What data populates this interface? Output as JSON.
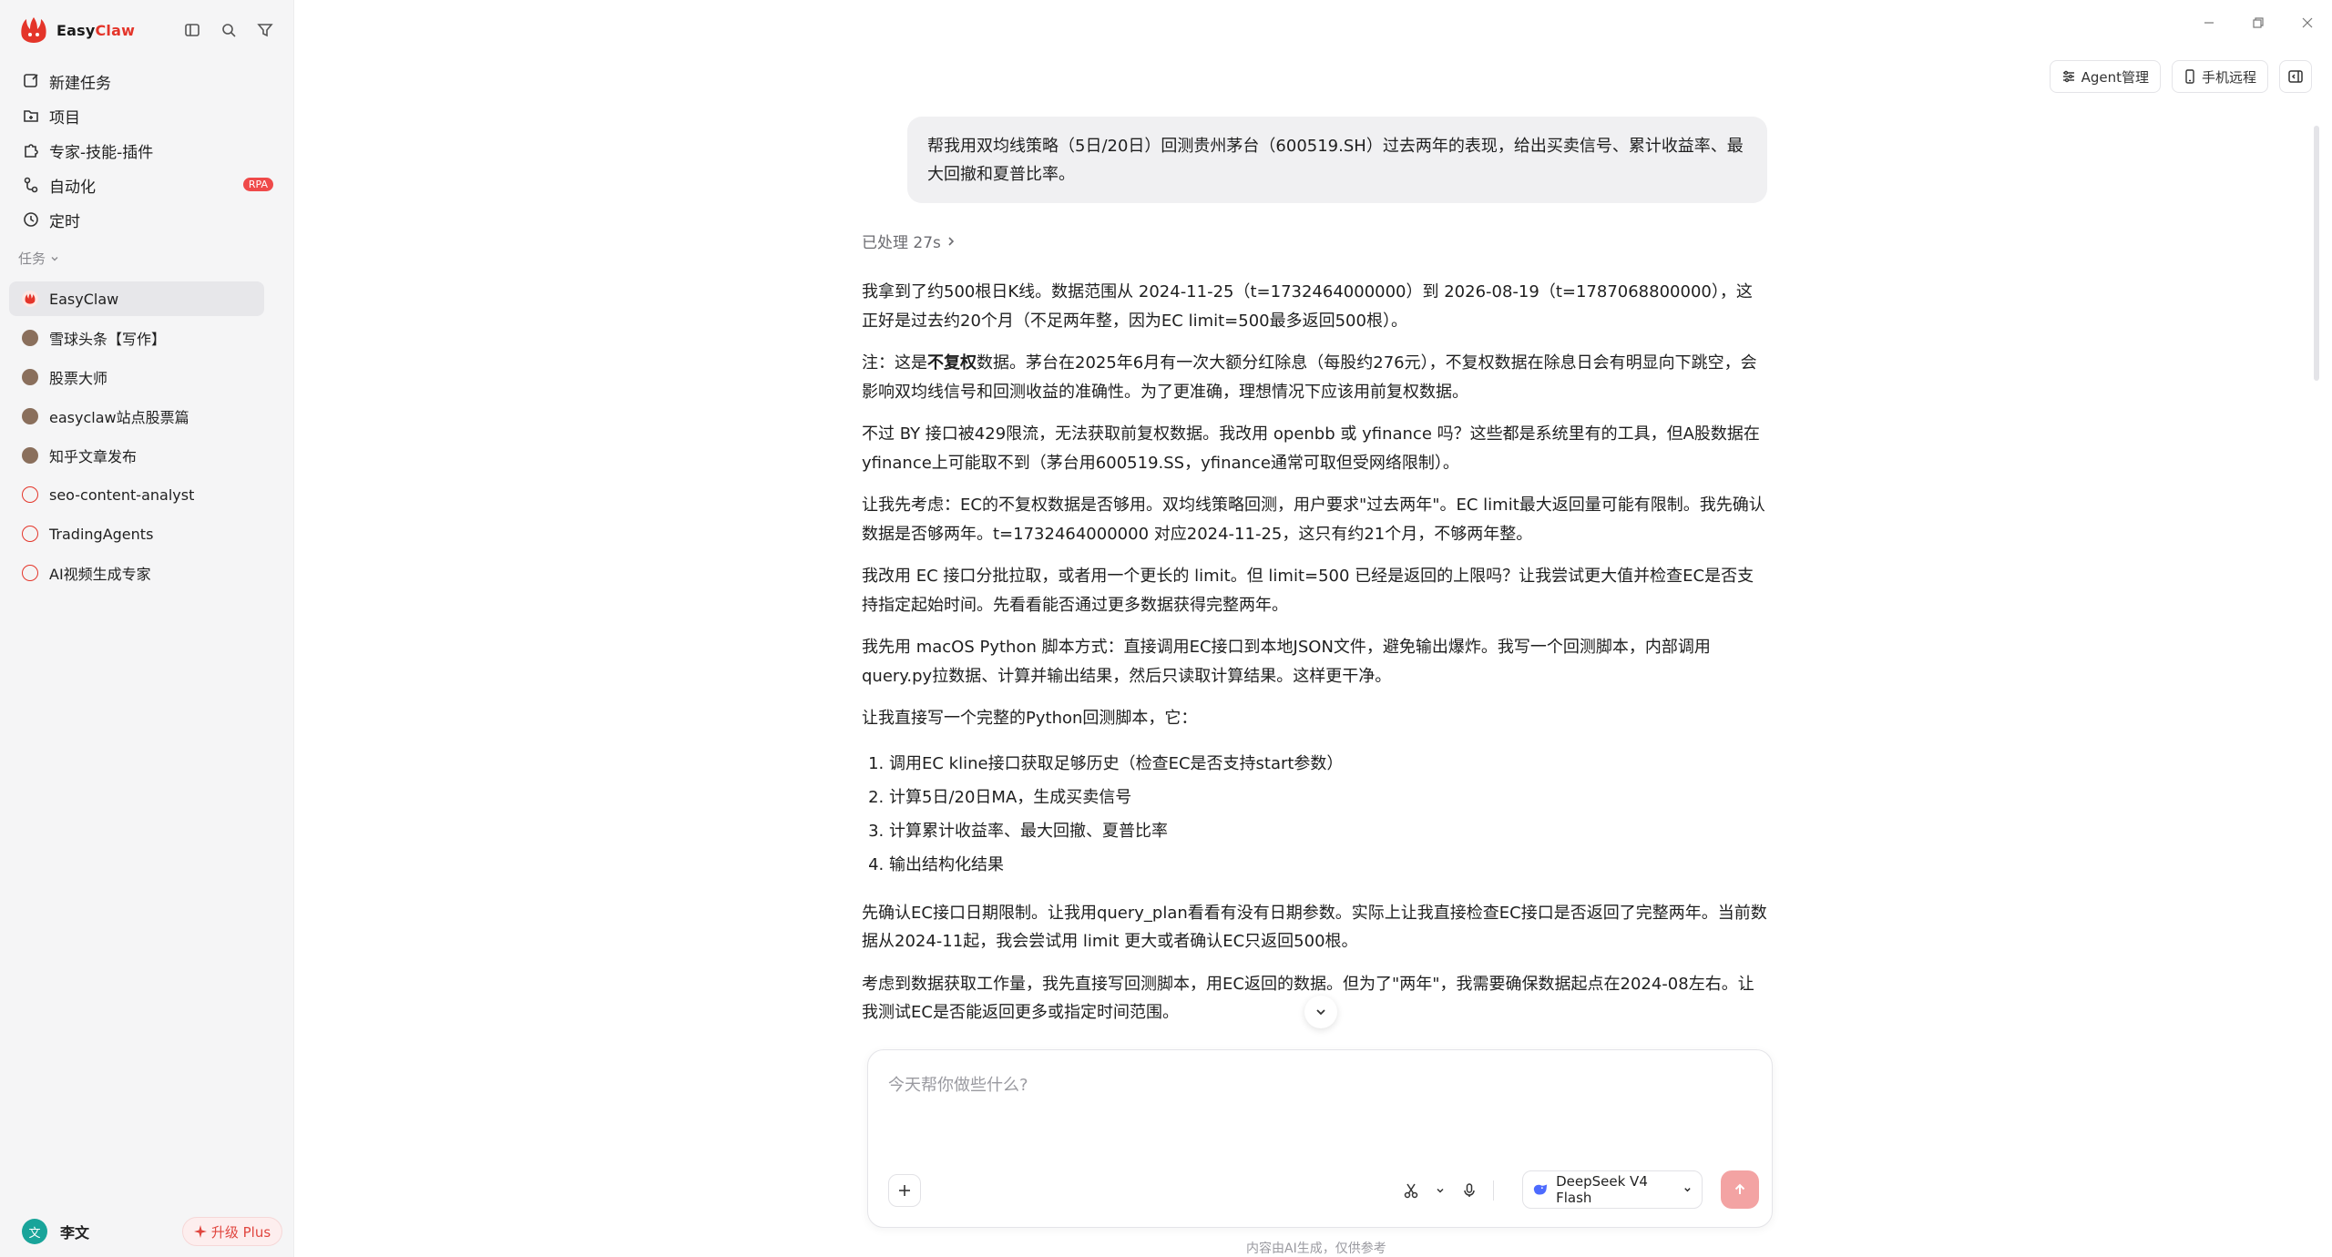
{
  "brand": {
    "name_prefix": "Easy",
    "name_suffix": "Claw",
    "accent": "#e4352a"
  },
  "sidebar": {
    "nav": [
      {
        "label": "新建任务",
        "icon": "new-task-icon"
      },
      {
        "label": "项目",
        "icon": "folder-icon"
      },
      {
        "label": "专家-技能-插件",
        "icon": "puzzle-icon"
      },
      {
        "label": "自动化",
        "icon": "automation-icon",
        "badge": "RPA"
      },
      {
        "label": "定时",
        "icon": "clock-icon"
      }
    ],
    "section_label": "任务",
    "tasks": [
      {
        "label": "EasyClaw",
        "avatar": "claw",
        "active": true
      },
      {
        "label": "雪球头条【写作】",
        "avatar": "person"
      },
      {
        "label": "股票大师",
        "avatar": "person"
      },
      {
        "label": "easyclaw站点股票篇",
        "avatar": "person"
      },
      {
        "label": "知乎文章发布",
        "avatar": "person"
      },
      {
        "label": "seo-content-analyst",
        "avatar": "robot"
      },
      {
        "label": "TradingAgents",
        "avatar": "robot"
      },
      {
        "label": "AI视频生成专家",
        "avatar": "robot"
      }
    ],
    "user": {
      "avatar_text": "文",
      "name": "李文"
    },
    "upgrade_label": "升级 Plus"
  },
  "top_actions": {
    "agent_label": "Agent管理",
    "mobile_label": "手机远程"
  },
  "chat": {
    "user_message": "帮我用双均线策略（5日/20日）回测贵州茅台（600519.SH）过去两年的表现，给出买卖信号、累计收益率、最大回撤和夏普比率。",
    "processed_label": "已处理 27s",
    "paragraphs": {
      "p1": "我拿到了约500根日K线。数据范围从 2024-11-25（t=1732464000000）到 2026-08-19（t=1787068800000），这正好是过去约20个月（不足两年整，因为EC limit=500最多返回500根）。",
      "p2_pre": "注：这是",
      "p2_bold": "不复权",
      "p2_post": "数据。茅台在2025年6月有一次大额分红除息（每股约276元），不复权数据在除息日会有明显向下跳空，会影响双均线信号和回测收益的准确性。为了更准确，理想情况下应该用前复权数据。",
      "p3": "不过 BY 接口被429限流，无法获取前复权数据。我改用 openbb 或 yfinance 吗？这些都是系统里有的工具，但A股数据在yfinance上可能取不到（茅台用600519.SS，yfinance通常可取但受网络限制）。",
      "p4": "让我先考虑：EC的不复权数据是否够用。双均线策略回测，用户要求\"过去两年\"。EC limit最大返回量可能有限制。我先确认数据是否够两年。t=1732464000000 对应2024-11-25，这只有约21个月，不够两年整。",
      "p5": "我改用 EC 接口分批拉取，或者用一个更长的 limit。但 limit=500 已经是返回的上限吗？让我尝试更大值并检查EC是否支持指定起始时间。先看看能否通过更多数据获得完整两年。",
      "p6": "我先用 macOS Python 脚本方式：直接调用EC接口到本地JSON文件，避免输出爆炸。我写一个回测脚本，内部调用query.py拉数据、计算并输出结果，然后只读取计算结果。这样更干净。",
      "p7": "让我直接写一个完整的Python回测脚本，它：",
      "p8": "先确认EC接口日期限制。让我用query_plan看看有没有日期参数。实际上让我直接检查EC接口是否返回了完整两年。当前数据从2024-11起，我会尝试用 limit 更大或者确认EC只返回500根。",
      "p9": "考虑到数据获取工作量，我先直接写回测脚本，用EC返回的数据。但为了\"两年\"，我需要确保数据起点在2024-08左右。让我测试EC是否能返回更多或指定时间范围。"
    },
    "steps": [
      "调用EC kline接口获取足够历史（检查EC是否支持start参数）",
      "计算5日/20日MA，生成买卖信号",
      "计算累计收益率、最大回撤、夏普比率",
      "输出结构化结果"
    ]
  },
  "composer": {
    "placeholder": "今天帮你做些什么?",
    "model_label": "DeepSeek V4 Flash",
    "send_color": "#f3a3a3"
  },
  "disclaimer": "内容由AI生成，仅供参考"
}
